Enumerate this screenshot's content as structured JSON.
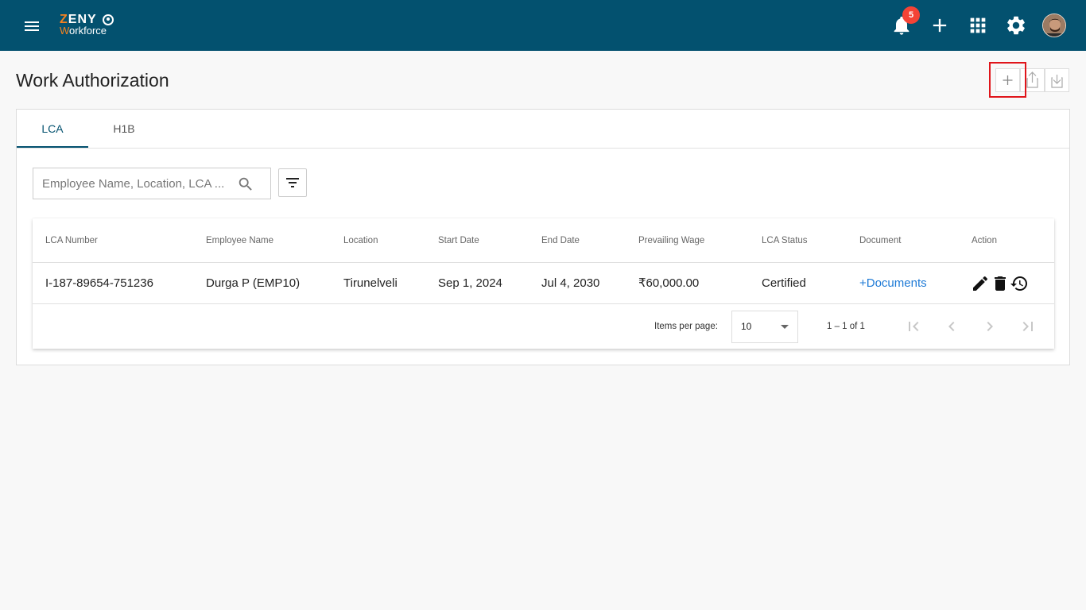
{
  "app": {
    "logo_top": "ZENY",
    "logo_bottom": "Workforce",
    "notification_count": "5"
  },
  "page": {
    "title": "Work Authorization"
  },
  "tabs": [
    {
      "label": "LCA",
      "active": true
    },
    {
      "label": "H1B",
      "active": false
    }
  ],
  "search": {
    "placeholder": "Employee Name, Location, LCA ..."
  },
  "table": {
    "columns": [
      "LCA Number",
      "Employee Name",
      "Location",
      "Start Date",
      "End Date",
      "Prevailing Wage",
      "LCA Status",
      "Document",
      "Action"
    ],
    "rows": [
      {
        "lca_number": "I-187-89654-751236",
        "employee_name": "Durga P (EMP10)",
        "location": "Tirunelveli",
        "start_date": "Sep 1, 2024",
        "end_date": "Jul 4, 2030",
        "prevailing_wage": "₹60,000.00",
        "lca_status": "Certified",
        "document": "+Documents"
      }
    ]
  },
  "paginator": {
    "items_per_page_label": "Items per page:",
    "items_per_page": "10",
    "range": "1 – 1 of 1"
  },
  "icons": {
    "menu": "menu-icon",
    "notifications": "bell-icon",
    "add": "plus-icon",
    "apps": "apps-grid-icon",
    "settings": "gear-icon",
    "search": "search-icon",
    "filter": "filter-icon",
    "upload": "upload-icon",
    "download": "download-icon",
    "edit": "pencil-icon",
    "delete": "trash-icon",
    "history": "history-icon"
  },
  "colors": {
    "header": "#03516f",
    "accent_orange": "#f58220",
    "badge": "#f44336",
    "link": "#1e7ad6",
    "highlight": "#e0151b"
  }
}
